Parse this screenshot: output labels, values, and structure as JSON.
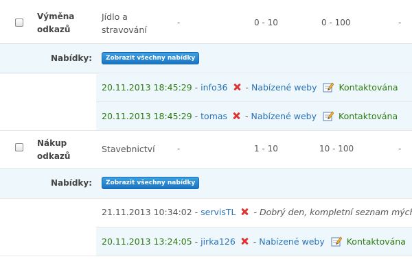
{
  "tasks": [
    {
      "title_line1": "Výměna",
      "title_line2": "odkazů",
      "category_line1": "Jídlo a",
      "category_line2": "stravování",
      "col_a": "-",
      "col_b": "0 - 10",
      "col_c": "0 - 100",
      "col_d": "-",
      "offers_label": "Nabídky:",
      "show_all_button": "Zobrazit všechny nabídky",
      "offers": [
        {
          "datetime": "20.11.2013 18:45:29",
          "sep": " - ",
          "user": "info36",
          "sep2": " - ",
          "offer_type": "Nabízené weby",
          "status": "Kontaktována"
        },
        {
          "datetime": "20.11.2013 18:45:29",
          "sep": " - ",
          "user": "tomas",
          "sep2": " - ",
          "offer_type": "Nabízené weby",
          "status": "Kontaktována"
        }
      ]
    },
    {
      "title_line1": "Nákup",
      "title_line2": "odkazů",
      "category_line1": "Stavebnictví",
      "col_a": "-",
      "col_b": "1 - 10",
      "col_c": "10 - 100",
      "col_d": "-",
      "offers_label": "Nabídky:",
      "show_all_button": "Zobrazit všechny nabídky",
      "offers": [
        {
          "datetime": "21.11.2013 10:34:02",
          "sep": " - ",
          "user": "servisTL",
          "sep2": " - ",
          "message": "Dobrý den, kompletní seznam mých"
        },
        {
          "datetime": "20.11.2013 13:24:05",
          "sep": " - ",
          "user": "jirka126",
          "sep2": " - ",
          "offer_type": "Nabízené weby",
          "status": "Kontaktována"
        }
      ]
    }
  ],
  "colors": {
    "green": "#2c7b12",
    "blue": "#2a72b8",
    "panel": "#eef7fb",
    "button": "#1a74c4",
    "delete": "#dd3333"
  },
  "icons": {
    "delete": "red-x-icon",
    "edit": "pencil-edit-icon",
    "checkbox": "checkbox"
  }
}
